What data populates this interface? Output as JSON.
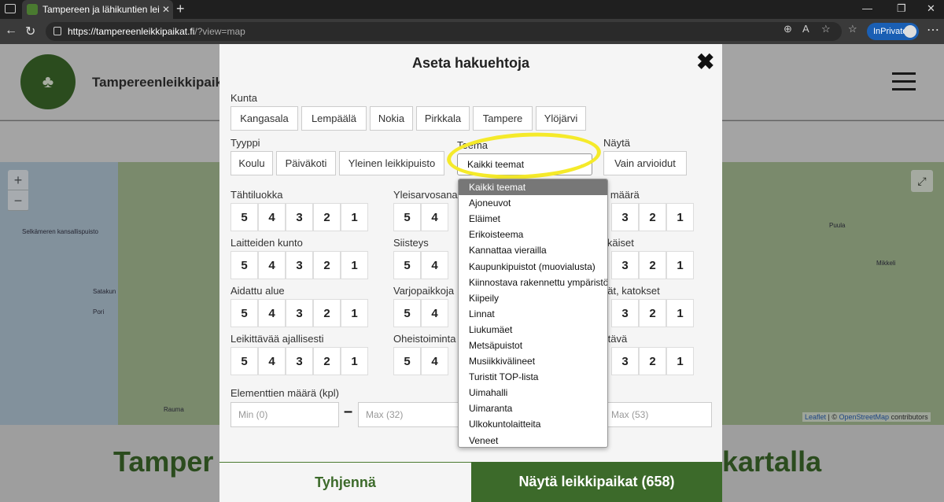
{
  "browser": {
    "tab_title": "Tampereen ja lähikuntien leikkipui",
    "url_host": "https://tampereenleikkipaikat.fi",
    "url_path": "/?view=map",
    "inprivate_label": "InPrivate"
  },
  "site": {
    "name": "Tampereenleikkipaik",
    "bottom_title_left": "Tamper",
    "bottom_title_right": "kartalla"
  },
  "map": {
    "labels": [
      "Selkämeren kansallispuisto",
      "Satakun",
      "Pori",
      "Rauma",
      "Mikkeli",
      "Puula"
    ],
    "attribution_leaflet": "Leaflet",
    "attribution_sep": " | © ",
    "attribution_osm": "OpenStreetMap",
    "attribution_tail": " contributors"
  },
  "modal": {
    "title": "Aseta hakuehtoja",
    "kunta_label": "Kunta",
    "kunta_options": [
      "Kangasala",
      "Lempäälä",
      "Nokia",
      "Pirkkala",
      "Tampere",
      "Ylöjärvi"
    ],
    "tyyppi_label": "Tyyppi",
    "tyyppi_options": [
      "Koulu",
      "Päiväkoti",
      "Yleinen leikkipuisto"
    ],
    "teema_label": "Teema",
    "teema_selected": "Kaikki teemat",
    "nayta_label": "Näytä",
    "nayta_option": "Vain arvioidut",
    "left_ratings": [
      "Tähtiluokka",
      "Laitteiden kunto",
      "Aidattu alue",
      "Leikittävää ajallisesti"
    ],
    "mid_ratings": [
      "Yleisarvosana",
      "Siisteys",
      "Varjopaikkoja",
      "Oheistoiminta"
    ],
    "right_ratings": [
      "n määrä",
      "ikäiset",
      "dät, katokset",
      "ttävä"
    ],
    "rating_values": [
      "5",
      "4",
      "3",
      "2",
      "1"
    ],
    "elements_label": "Elementtien määrä (kpl)",
    "min_placeholder": "Min (0)",
    "max_placeholder": "Max (32)",
    "max2_placeholder": "Max (53)",
    "dash": "–",
    "clear_button": "Tyhjennä",
    "show_button": "Näytä leikkipaikat  (658)"
  },
  "teema_dropdown": [
    "Kaikki teemat",
    "Ajoneuvot",
    "Eläimet",
    "Erikoisteema",
    "Kannattaa vierailla",
    "Kaupunkipuistot (muovialusta)",
    "Kiinnostava rakennettu ympäristö",
    "Kiipeily",
    "Linnat",
    "Liukumäet",
    "Metsäpuistot",
    "Musiikkivälineet",
    "Turistit TOP-lista",
    "Uimahalli",
    "Uimaranta",
    "Ulkokuntolaitteita",
    "Veneet"
  ]
}
